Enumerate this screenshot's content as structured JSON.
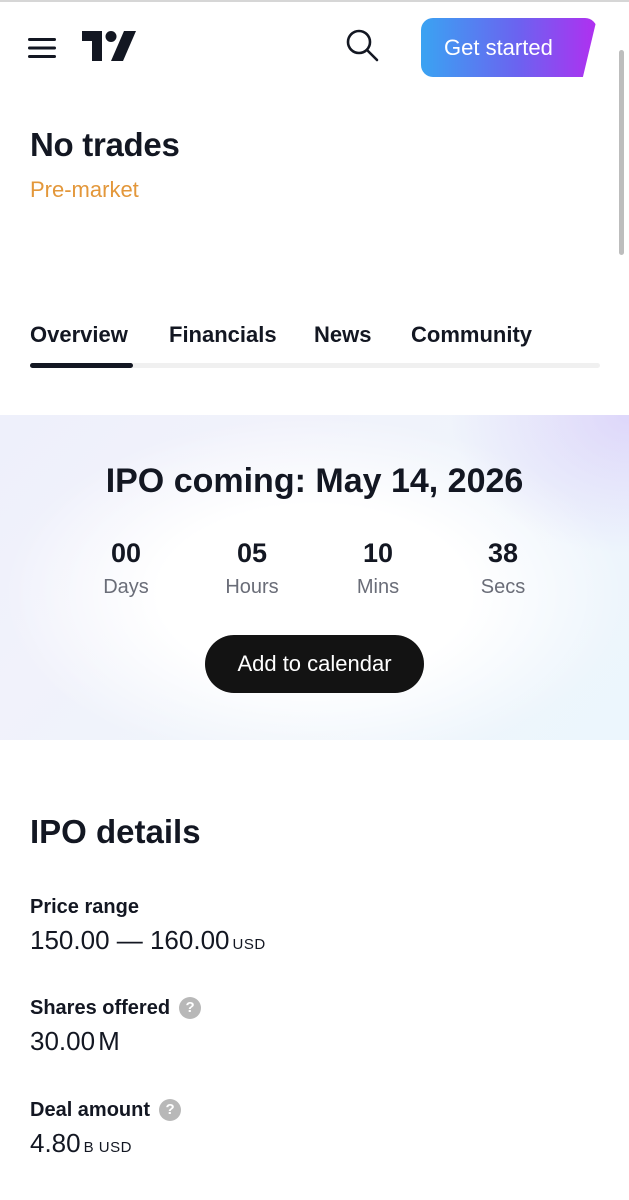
{
  "header": {
    "menu_icon": "hamburger-menu-icon",
    "logo_icon": "tradingview-logo-icon",
    "search_icon": "search-icon",
    "cta_label": "Get started"
  },
  "symbol": {
    "title": "No trades",
    "status": "Pre-market",
    "status_color": "#e3973a"
  },
  "tabs": [
    {
      "label": "Overview",
      "active": true
    },
    {
      "label": "Financials",
      "active": false
    },
    {
      "label": "News",
      "active": false
    },
    {
      "label": "Community",
      "active": false
    }
  ],
  "ipo_banner": {
    "heading": "IPO coming: May 14, 2026",
    "countdown": [
      {
        "value": "00",
        "label": "Days"
      },
      {
        "value": "05",
        "label": "Hours"
      },
      {
        "value": "10",
        "label": "Mins"
      },
      {
        "value": "38",
        "label": "Secs"
      }
    ],
    "calendar_button": "Add to calendar"
  },
  "ipo_details": {
    "title": "IPO details",
    "items": [
      {
        "label": "Price range",
        "value": "150.00 — 160.00",
        "unit": "USD",
        "has_help": false
      },
      {
        "label": "Shares offered",
        "value": "30.00",
        "unit": "M",
        "has_help": true
      },
      {
        "label": "Deal amount",
        "value": "4.80",
        "unit": "B USD",
        "has_help": true
      }
    ],
    "help_icon": "question-mark-icon"
  },
  "colors": {
    "cta_gradient_start": "#3aa3f2",
    "cta_gradient_end": "#b12ff0",
    "text_primary": "#131722",
    "button_dark": "#131313"
  }
}
